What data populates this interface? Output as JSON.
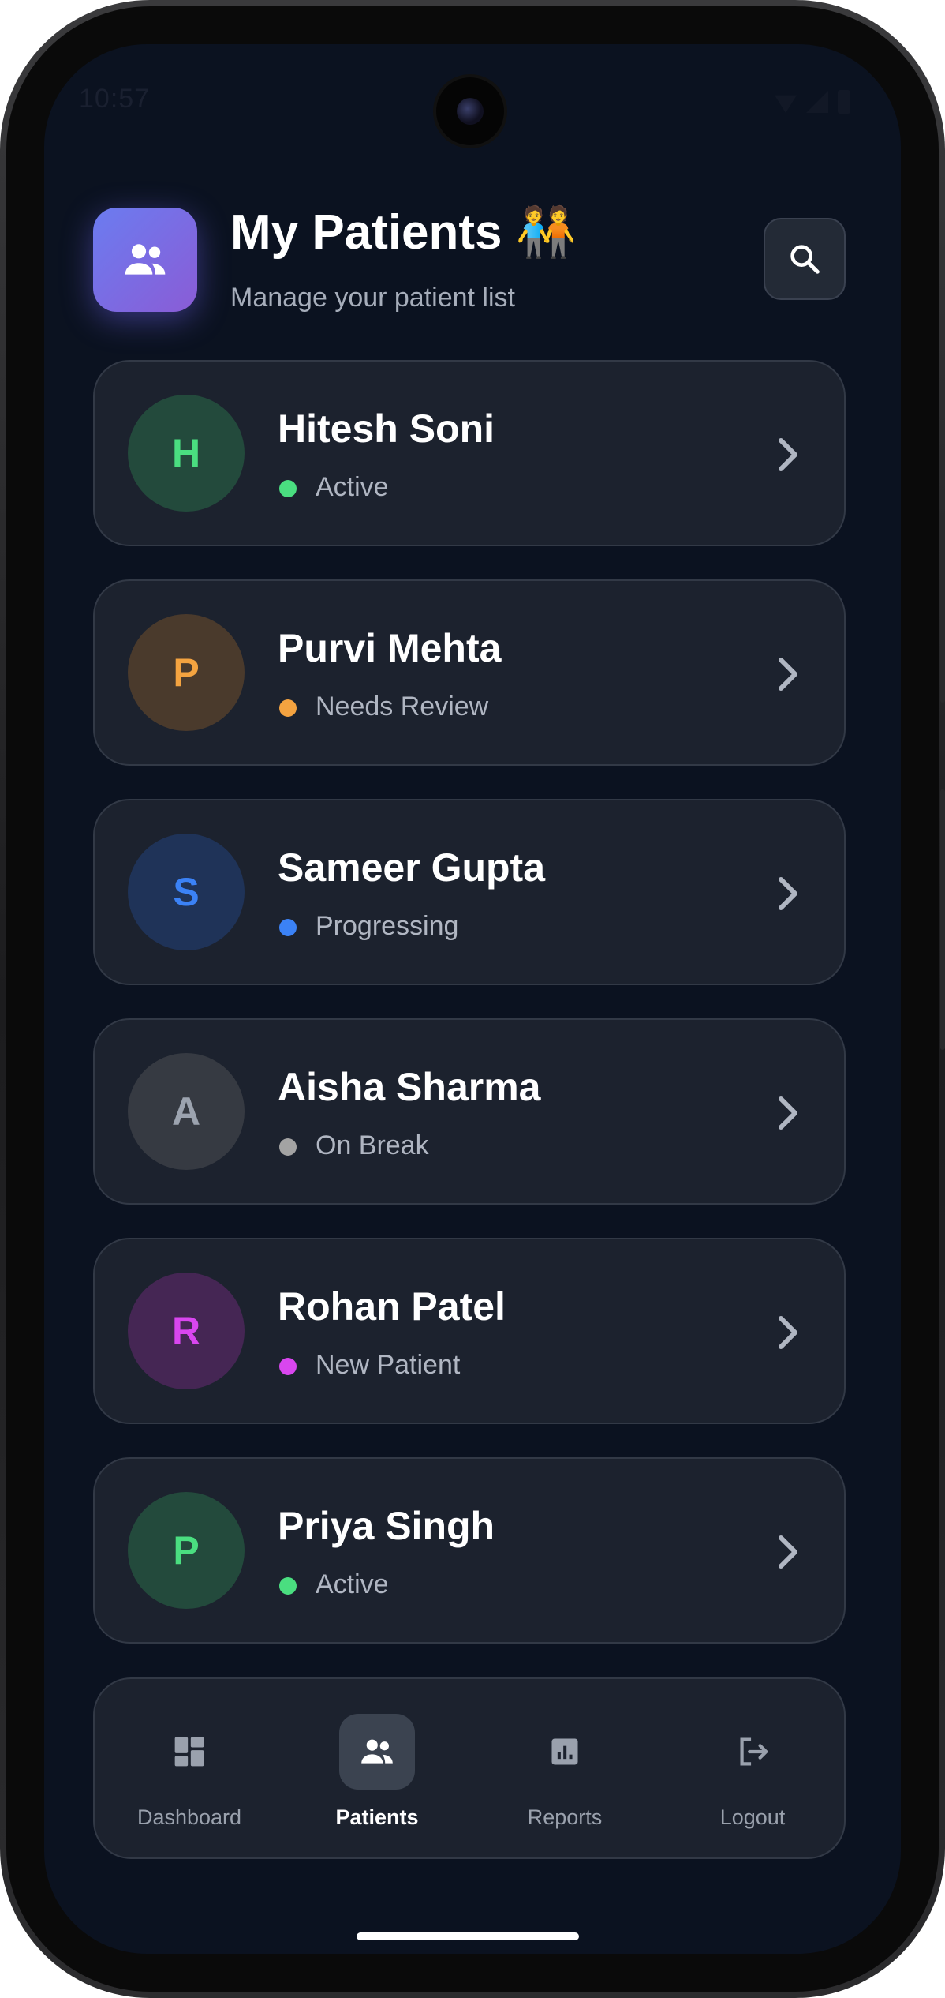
{
  "status_bar": {
    "time": "10:57"
  },
  "header": {
    "title": "My Patients 🧑‍🤝‍🧑",
    "subtitle": "Manage your patient list",
    "icon": "patients-group-icon",
    "accent_gradient": [
      "#6b7cf0",
      "#8a5cd6"
    ]
  },
  "patients": [
    {
      "initial": "H",
      "name": "Hitesh Soni",
      "status": "Active",
      "status_color": "#4ade80",
      "avatar_bg": "#234a3c",
      "avatar_fg": "#4ade80"
    },
    {
      "initial": "P",
      "name": "Purvi Mehta",
      "status": "Needs Review",
      "status_color": "#f4a340",
      "avatar_bg": "#4a3a2c",
      "avatar_fg": "#f4a340"
    },
    {
      "initial": "S",
      "name": "Sameer Gupta",
      "status": "Progressing",
      "status_color": "#3b82f6",
      "avatar_bg": "#1f3358",
      "avatar_fg": "#3b82f6"
    },
    {
      "initial": "A",
      "name": "Aisha Sharma",
      "status": "On Break",
      "status_color": "#a3a3a3",
      "avatar_bg": "#363a42",
      "avatar_fg": "#9ca3af"
    },
    {
      "initial": "R",
      "name": "Rohan Patel",
      "status": "New Patient",
      "status_color": "#d946ef",
      "avatar_bg": "#452654",
      "avatar_fg": "#d946ef"
    },
    {
      "initial": "P",
      "name": "Priya Singh",
      "status": "Active",
      "status_color": "#4ade80",
      "avatar_bg": "#234a3c",
      "avatar_fg": "#4ade80"
    }
  ],
  "bottom_nav": [
    {
      "label": "Dashboard",
      "icon": "dashboard-icon",
      "active": false
    },
    {
      "label": "Patients",
      "icon": "patients-icon",
      "active": true
    },
    {
      "label": "Reports",
      "icon": "reports-icon",
      "active": false
    },
    {
      "label": "Logout",
      "icon": "logout-icon",
      "active": false
    }
  ]
}
